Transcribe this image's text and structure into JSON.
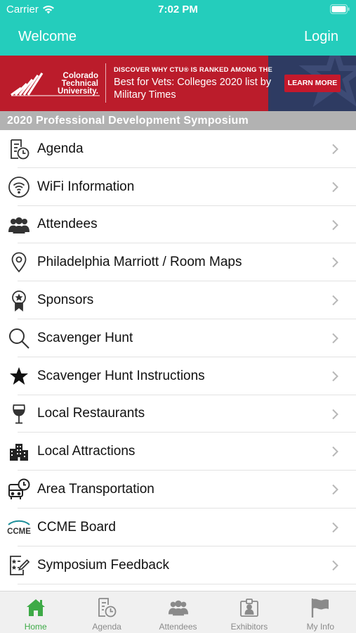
{
  "status_bar": {
    "carrier": "Carrier",
    "time": "7:02 PM"
  },
  "nav": {
    "left": "Welcome",
    "right": "Login"
  },
  "banner": {
    "logo_line1": "Colorado",
    "logo_line2": "Technical",
    "logo_line3": "University.",
    "headline_small": "DISCOVER WHY CTU® IS RANKED AMONG THE",
    "headline_main": "Best for Vets: Colleges 2020 list by Military Times",
    "cta": "LEARN MORE"
  },
  "section_title": "2020 Professional Development Symposium",
  "menu": [
    {
      "label": "Agenda",
      "icon": "agenda-clock-icon"
    },
    {
      "label": "WiFi Information",
      "icon": "wifi-icon"
    },
    {
      "label": "Attendees",
      "icon": "people-icon"
    },
    {
      "label": "Philadelphia Marriott / Room Maps",
      "icon": "location-pin-icon"
    },
    {
      "label": "Sponsors",
      "icon": "ribbon-star-icon"
    },
    {
      "label": "Scavenger Hunt",
      "icon": "magnifier-icon"
    },
    {
      "label": "Scavenger Hunt Instructions",
      "icon": "star-icon"
    },
    {
      "label": "Local Restaurants",
      "icon": "wine-glass-icon"
    },
    {
      "label": "Local Attractions",
      "icon": "city-buildings-icon"
    },
    {
      "label": "Area Transportation",
      "icon": "bus-clock-icon"
    },
    {
      "label": "CCME Board",
      "icon": "ccme-logo-icon",
      "icon_text": "CCME"
    },
    {
      "label": "Symposium Feedback",
      "icon": "feedback-form-icon"
    }
  ],
  "tabs": [
    {
      "label": "Home",
      "icon": "home-icon",
      "active": true
    },
    {
      "label": "Agenda",
      "icon": "agenda-clock-icon",
      "active": false
    },
    {
      "label": "Attendees",
      "icon": "people-icon",
      "active": false
    },
    {
      "label": "Exhibitors",
      "icon": "badge-icon",
      "active": false
    },
    {
      "label": "My Info",
      "icon": "flag-icon",
      "active": false
    }
  ],
  "colors": {
    "accent": "#24cdbc",
    "banner_red": "#bb1c2b",
    "banner_navy": "#2e3b62",
    "section_gray": "#b2b2b2",
    "tab_active": "#3eaa47",
    "tab_inactive": "#8a8a8a"
  }
}
